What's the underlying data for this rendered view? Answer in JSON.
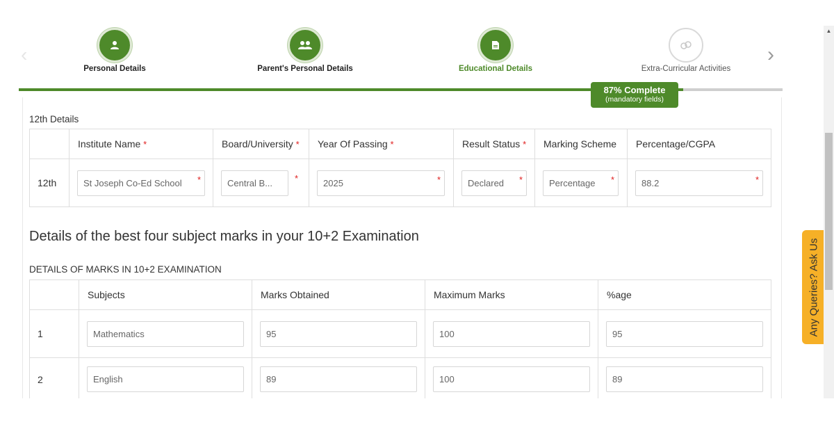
{
  "stepper": {
    "steps": [
      {
        "label": "Personal Details",
        "icon": "user-icon",
        "state": "done"
      },
      {
        "label": "Parent's Personal Details",
        "icon": "parents-icon",
        "state": "done"
      },
      {
        "label": "Educational Details",
        "icon": "document-icon",
        "state": "active"
      },
      {
        "label": "Extra-Curricular Activities",
        "icon": "activities-icon",
        "state": "pending"
      }
    ],
    "progress_percent": 87,
    "progress_text": "87% Complete",
    "progress_subtext": "(mandatory fields)",
    "accent_color": "#4e8a2a"
  },
  "twelfth": {
    "section_label": "12th Details",
    "headers": {
      "institute": "Institute Name",
      "board": "Board/University",
      "year": "Year Of Passing",
      "result": "Result Status",
      "marking": "Marking Scheme",
      "percentage": "Percentage/CGPA"
    },
    "required_marker": "*",
    "row": {
      "label": "12th",
      "institute": "St Joseph Co-Ed School",
      "board": "Central B...",
      "year": "2025",
      "result": "Declared",
      "marking": "Percentage",
      "percentage": "88.2"
    }
  },
  "marks": {
    "heading": "Details of the best four subject marks in your 10+2 Examination",
    "section_label": "DETAILS OF MARKS IN 10+2 EXAMINATION",
    "headers": {
      "subjects": "Subjects",
      "obtained": "Marks Obtained",
      "maximum": "Maximum Marks",
      "percent": "%age"
    },
    "rows": [
      {
        "index": "1",
        "subject": "Mathematics",
        "obtained": "95",
        "maximum": "100",
        "percent": "95"
      },
      {
        "index": "2",
        "subject": "English",
        "obtained": "89",
        "maximum": "100",
        "percent": "89"
      }
    ]
  },
  "side_tab": {
    "label": "Any Queries? Ask Us",
    "color": "#f6b027"
  }
}
